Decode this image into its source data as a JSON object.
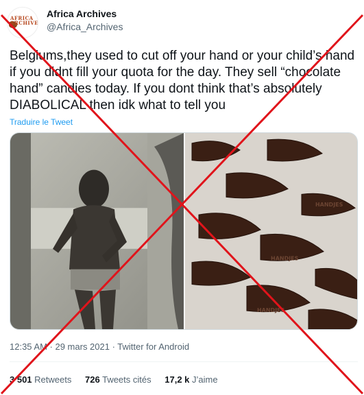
{
  "author": {
    "display_name": "Africa Archives",
    "handle": "@Africa_Archives",
    "avatar_logo_text": "AFRICA ARCHIVES"
  },
  "tweet": {
    "text": "Belgiums,they used to cut off your hand or your child’s hand if you didnt fill your quota for the day. They sell “chocolate hand” candies today. If you dont think that’s absolutely DIABOLICAL then idk what to tell you",
    "translate_label": "Traduire le Tweet",
    "timestamp": "12:35 AM · 29 mars 2021 · Twitter for Android",
    "candy_label": "HANDJES"
  },
  "stats": {
    "retweets_count": "3 501",
    "retweets_label": "Retweets",
    "quotes_count": "726",
    "quotes_label": "Tweets cités",
    "likes_count": "17,2 k",
    "likes_label": "J’aime"
  },
  "overlay": {
    "cross_color": "#e0141b"
  }
}
